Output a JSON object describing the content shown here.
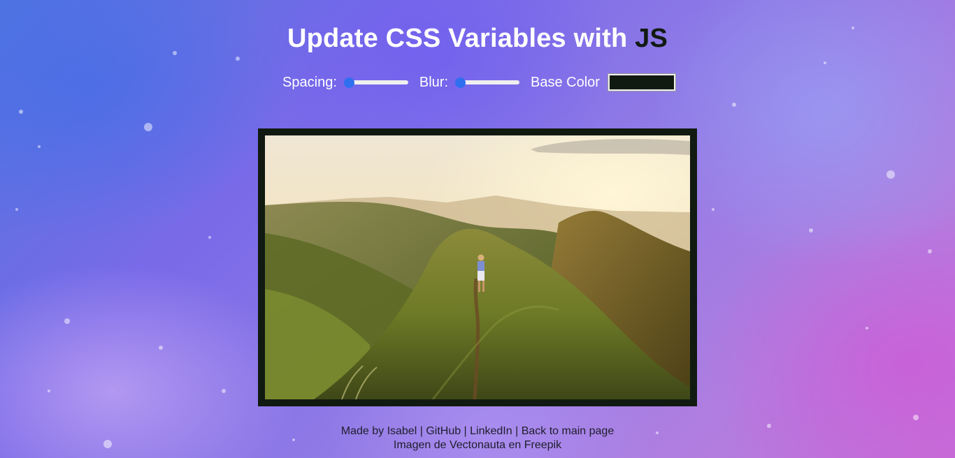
{
  "header": {
    "title_main": "Update CSS Variables with ",
    "title_highlight": "JS"
  },
  "controls": {
    "spacing_label": "Spacing:",
    "spacing_value": 10,
    "spacing_min": 10,
    "spacing_max": 200,
    "blur_label": "Blur:",
    "blur_value": 0,
    "blur_min": 0,
    "blur_max": 25,
    "base_color_label": "Base Color",
    "base_color_value": "#111a11"
  },
  "colors": {
    "base": "#111a11",
    "slider_accent": "#2f6ff0"
  },
  "image": {
    "alt": "Hiker walking along a mountain ridge trail at sunset",
    "icon": "landscape-photo"
  },
  "footer": {
    "made_by": "Made by Isabel",
    "github": "GitHub",
    "linkedin": "LinkedIn",
    "back": "Back to main page",
    "sep": " | ",
    "credit": "Imagen de Vectonauta en Freepik"
  }
}
